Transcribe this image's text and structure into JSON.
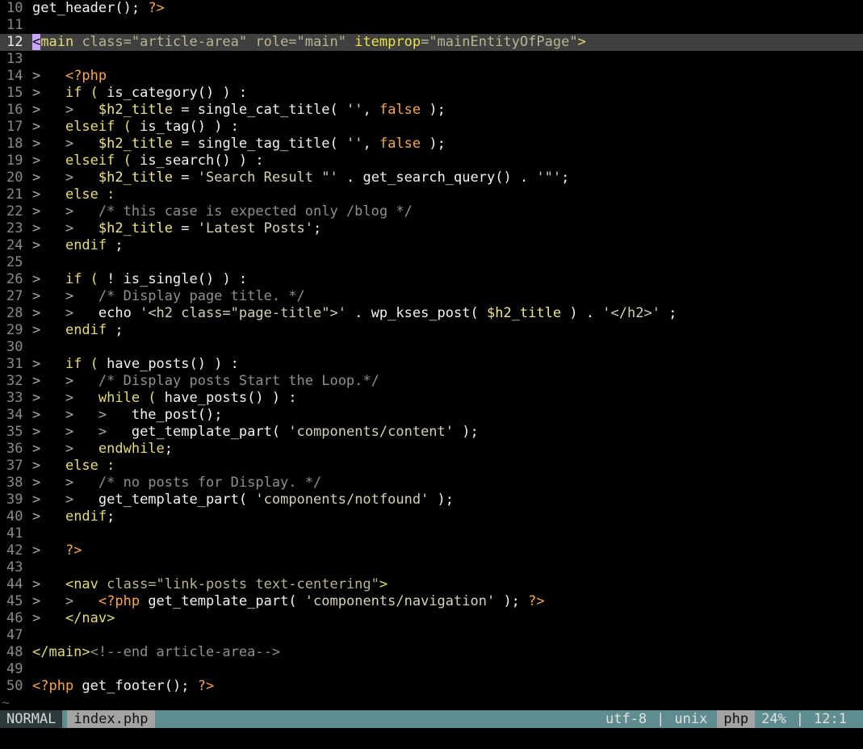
{
  "window": {
    "mode": "NORMAL"
  },
  "statusline": {
    "mode": "NORMAL",
    "filename": "index.php",
    "encoding": "utf-8",
    "separator": "|",
    "fileformat": "unix",
    "filetype": "php",
    "percent": "24%",
    "position": "12:1"
  },
  "tilde": "~",
  "cursor_line": 12,
  "lines": [
    {
      "n": "10",
      "t": [
        [
          "get_header",
          "fn"
        ],
        [
          "(); ",
          "op"
        ],
        [
          "?>",
          "php"
        ]
      ]
    },
    {
      "n": "11",
      "t": []
    },
    {
      "n": "12",
      "cur": true,
      "t": [
        [
          "<",
          "cursor"
        ],
        [
          "main ",
          "tag"
        ],
        [
          "class=\"article-area\" role=\"main\" ",
          "attr"
        ],
        [
          "itemprop",
          "sel"
        ],
        [
          "=\"mainEntityOfPage\"",
          "attr"
        ],
        [
          ">",
          "tag"
        ]
      ]
    },
    {
      "n": "13",
      "t": []
    },
    {
      "n": "14",
      "t": [
        [
          ">   ",
          "ind"
        ],
        [
          "<?php",
          "php"
        ]
      ]
    },
    {
      "n": "15",
      "t": [
        [
          ">   ",
          "ind"
        ],
        [
          "if ( ",
          "kw"
        ],
        [
          "is_category",
          "fn"
        ],
        [
          "() ) :",
          "op"
        ]
      ]
    },
    {
      "n": "16",
      "t": [
        [
          ">   >   ",
          "ind"
        ],
        [
          "$h2_title",
          "var"
        ],
        [
          " = ",
          "op"
        ],
        [
          "single_cat_title",
          "fn"
        ],
        [
          "( ",
          "op"
        ],
        [
          "''",
          "str"
        ],
        [
          ", ",
          "op"
        ],
        [
          "false",
          "bool"
        ],
        [
          " );",
          "op"
        ]
      ]
    },
    {
      "n": "17",
      "t": [
        [
          ">   ",
          "ind"
        ],
        [
          "elseif ( ",
          "kw"
        ],
        [
          "is_tag",
          "fn"
        ],
        [
          "() ) :",
          "op"
        ]
      ]
    },
    {
      "n": "18",
      "t": [
        [
          ">   >   ",
          "ind"
        ],
        [
          "$h2_title",
          "var"
        ],
        [
          " = ",
          "op"
        ],
        [
          "single_tag_title",
          "fn"
        ],
        [
          "( ",
          "op"
        ],
        [
          "''",
          "str"
        ],
        [
          ", ",
          "op"
        ],
        [
          "false",
          "bool"
        ],
        [
          " );",
          "op"
        ]
      ]
    },
    {
      "n": "19",
      "t": [
        [
          ">   ",
          "ind"
        ],
        [
          "elseif ( ",
          "kw"
        ],
        [
          "is_search",
          "fn"
        ],
        [
          "() ) :",
          "op"
        ]
      ]
    },
    {
      "n": "20",
      "t": [
        [
          ">   >   ",
          "ind"
        ],
        [
          "$h2_title",
          "var"
        ],
        [
          " = ",
          "op"
        ],
        [
          "'Search Result \"'",
          "str"
        ],
        [
          " . ",
          "op"
        ],
        [
          "get_search_query",
          "fn"
        ],
        [
          "() . ",
          "op"
        ],
        [
          "'\"'",
          "str"
        ],
        [
          ";",
          "op"
        ]
      ]
    },
    {
      "n": "21",
      "t": [
        [
          ">   ",
          "ind"
        ],
        [
          "else :",
          "kw"
        ]
      ]
    },
    {
      "n": "22",
      "t": [
        [
          ">   >   ",
          "ind"
        ],
        [
          "/* this case is expected only /blog */",
          "cm"
        ]
      ]
    },
    {
      "n": "23",
      "t": [
        [
          ">   >   ",
          "ind"
        ],
        [
          "$h2_title",
          "var"
        ],
        [
          " = ",
          "op"
        ],
        [
          "'Latest Posts'",
          "str"
        ],
        [
          ";",
          "op"
        ]
      ]
    },
    {
      "n": "24",
      "t": [
        [
          ">   ",
          "ind"
        ],
        [
          "endif",
          "kw"
        ],
        [
          " ;",
          "op"
        ]
      ]
    },
    {
      "n": "25",
      "t": []
    },
    {
      "n": "26",
      "t": [
        [
          ">   ",
          "ind"
        ],
        [
          "if ( ",
          "kw"
        ],
        [
          "! ",
          "op"
        ],
        [
          "is_single",
          "fn"
        ],
        [
          "() ) :",
          "op"
        ]
      ]
    },
    {
      "n": "27",
      "t": [
        [
          ">   >   ",
          "ind"
        ],
        [
          "/* Display page title. */",
          "cm"
        ]
      ]
    },
    {
      "n": "28",
      "t": [
        [
          ">   >   ",
          "ind"
        ],
        [
          "echo ",
          "fn"
        ],
        [
          "'<h2 class=\"page-title\">'",
          "str"
        ],
        [
          " . ",
          "op"
        ],
        [
          "wp_kses_post",
          "fn"
        ],
        [
          "( ",
          "op"
        ],
        [
          "$h2_title",
          "var"
        ],
        [
          " ) . ",
          "op"
        ],
        [
          "'</h2>'",
          "str"
        ],
        [
          " ;",
          "op"
        ]
      ]
    },
    {
      "n": "29",
      "t": [
        [
          ">   ",
          "ind"
        ],
        [
          "endif",
          "kw"
        ],
        [
          " ;",
          "op"
        ]
      ]
    },
    {
      "n": "30",
      "t": []
    },
    {
      "n": "31",
      "t": [
        [
          ">   ",
          "ind"
        ],
        [
          "if ( ",
          "kw"
        ],
        [
          "have_posts",
          "fn"
        ],
        [
          "() ) :",
          "op"
        ]
      ]
    },
    {
      "n": "32",
      "t": [
        [
          ">   >   ",
          "ind"
        ],
        [
          "/* Display posts Start the Loop.*/",
          "cm"
        ]
      ]
    },
    {
      "n": "33",
      "t": [
        [
          ">   >   ",
          "ind"
        ],
        [
          "while ( ",
          "kw"
        ],
        [
          "have_posts",
          "fn"
        ],
        [
          "() ) :",
          "op"
        ]
      ]
    },
    {
      "n": "34",
      "t": [
        [
          ">   >   >   ",
          "ind"
        ],
        [
          "the_post",
          "fn"
        ],
        [
          "();",
          "op"
        ]
      ]
    },
    {
      "n": "35",
      "t": [
        [
          ">   >   >   ",
          "ind"
        ],
        [
          "get_template_part",
          "fn"
        ],
        [
          "( ",
          "op"
        ],
        [
          "'components/content'",
          "str"
        ],
        [
          " );",
          "op"
        ]
      ]
    },
    {
      "n": "36",
      "t": [
        [
          ">   >   ",
          "ind"
        ],
        [
          "endwhile",
          "kw"
        ],
        [
          ";",
          "op"
        ]
      ]
    },
    {
      "n": "37",
      "t": [
        [
          ">   ",
          "ind"
        ],
        [
          "else :",
          "kw"
        ]
      ]
    },
    {
      "n": "38",
      "t": [
        [
          ">   >   ",
          "ind"
        ],
        [
          "/* no posts for Display. */",
          "cm"
        ]
      ]
    },
    {
      "n": "39",
      "t": [
        [
          ">   >   ",
          "ind"
        ],
        [
          "get_template_part",
          "fn"
        ],
        [
          "( ",
          "op"
        ],
        [
          "'components/notfound'",
          "str"
        ],
        [
          " );",
          "op"
        ]
      ]
    },
    {
      "n": "40",
      "t": [
        [
          ">   ",
          "ind"
        ],
        [
          "endif",
          "kw"
        ],
        [
          ";",
          "op"
        ]
      ]
    },
    {
      "n": "41",
      "t": []
    },
    {
      "n": "42",
      "t": [
        [
          ">   ",
          "ind"
        ],
        [
          "?>",
          "php"
        ]
      ]
    },
    {
      "n": "43",
      "t": []
    },
    {
      "n": "44",
      "t": [
        [
          ">   ",
          "ind"
        ],
        [
          "<nav ",
          "tag"
        ],
        [
          "class=\"link-posts text-centering\"",
          "attr"
        ],
        [
          ">",
          "tag"
        ]
      ]
    },
    {
      "n": "45",
      "t": [
        [
          ">   >   ",
          "ind"
        ],
        [
          "<?php ",
          "php"
        ],
        [
          "get_template_part",
          "fn"
        ],
        [
          "( ",
          "op"
        ],
        [
          "'components/navigation'",
          "str"
        ],
        [
          " ); ",
          "op"
        ],
        [
          "?>",
          "php"
        ]
      ]
    },
    {
      "n": "46",
      "t": [
        [
          ">   ",
          "ind"
        ],
        [
          "</nav>",
          "tag"
        ]
      ]
    },
    {
      "n": "47",
      "t": []
    },
    {
      "n": "48",
      "t": [
        [
          "</main>",
          "tag"
        ],
        [
          "<!--end article-area-->",
          "cm"
        ]
      ]
    },
    {
      "n": "49",
      "t": []
    },
    {
      "n": "50",
      "t": [
        [
          "<?php ",
          "php"
        ],
        [
          "get_footer",
          "fn"
        ],
        [
          "(); ",
          "op"
        ],
        [
          "?>",
          "php"
        ]
      ]
    }
  ]
}
